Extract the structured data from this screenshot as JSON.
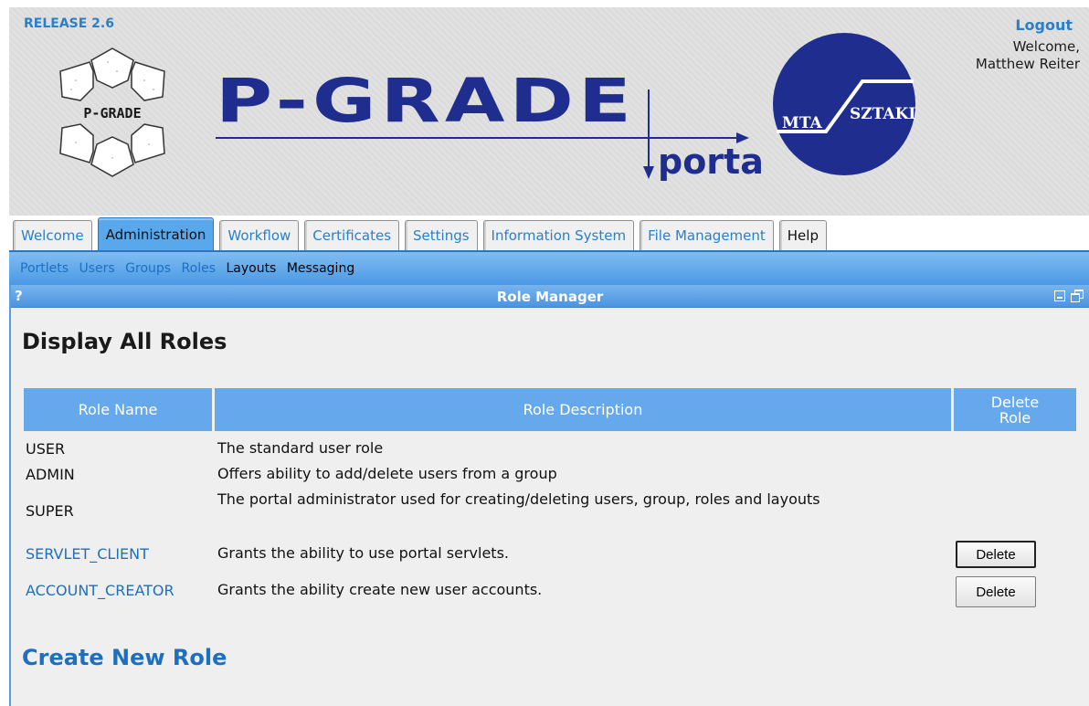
{
  "header": {
    "release": "RELEASE 2.6",
    "logout": "Logout",
    "welcome_line1": "Welcome,",
    "welcome_line2": "Matthew Reiter",
    "logo_left_text": "P-GRADE",
    "logo_title_text": "P-GRADE",
    "logo_portal_text": "portal",
    "logo_right_text1": "MTA",
    "logo_right_text2": "SZTAKI"
  },
  "tabs": [
    {
      "label": "Welcome"
    },
    {
      "label": "Administration",
      "active": true
    },
    {
      "label": "Workflow"
    },
    {
      "label": "Certificates"
    },
    {
      "label": "Settings"
    },
    {
      "label": "Information System"
    },
    {
      "label": "File Management"
    },
    {
      "label": "Help"
    }
  ],
  "subnav": [
    "Portlets",
    "Users",
    "Groups",
    "Roles",
    "Layouts",
    "Messaging"
  ],
  "portlet": {
    "help": "?",
    "title": "Role Manager",
    "heading": "Display All Roles",
    "columns": [
      "Role Name",
      "Role Description",
      "Delete Role"
    ],
    "rows": [
      {
        "name": "USER",
        "description": "The standard user role"
      },
      {
        "name": "ADMIN",
        "description": "Offers ability to add/delete users from a group"
      },
      {
        "name": "SUPER",
        "description": "The portal administrator used for creating/deleting users, group, roles and layouts"
      },
      {
        "name": "SERVLET_CLIENT",
        "description": "Grants the ability to use portal servlets.",
        "delete": "Delete"
      },
      {
        "name": "ACCOUNT_CREATOR",
        "description": "Grants the ability create new user accounts.",
        "delete": "Delete"
      }
    ],
    "create_heading": "Create New Role"
  },
  "colors": {
    "accent": "#2a7fc9",
    "tab_active": "#5aa8ec",
    "header_bg": "#dcdcdc",
    "logo_navy": "#1f2d8f"
  }
}
